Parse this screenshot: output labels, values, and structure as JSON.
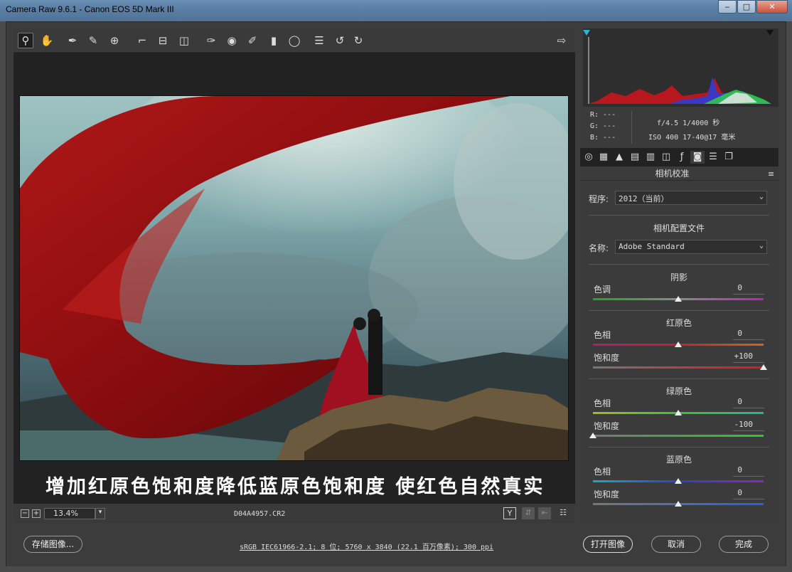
{
  "window": {
    "title": "Camera Raw 9.6.1 -  Canon EOS 5D Mark III"
  },
  "toolbar": {
    "tools": [
      "zoom-icon",
      "hand-icon",
      "white-balance-icon",
      "color-sampler-icon",
      "targeted-adjustment-icon",
      "crop-icon",
      "straighten-icon",
      "transform-icon",
      "spot-removal-icon",
      "red-eye-icon",
      "adjustment-brush-icon",
      "graduated-filter-icon",
      "radial-filter-icon",
      "preferences-icon",
      "rotate-left-icon",
      "rotate-right-icon"
    ],
    "open_in_new": "open-preferences-icon"
  },
  "preview": {
    "caption": "增加红原色饱和度降低蓝原色饱和度  使红色自然真实"
  },
  "status": {
    "zoom_minus": "−",
    "zoom_plus": "+",
    "zoom": "13.4%",
    "filename": "D04A4957.CR2",
    "before_after": "Y"
  },
  "histogram": {
    "rgb": {
      "r": "R:  ---",
      "g": "G:  ---",
      "b": "B:  ---"
    },
    "exif": {
      "aperture_shutter": "f/4.5   1/4000 秒",
      "iso_lens": "ISO 400   17-40@17 毫米"
    }
  },
  "panel": {
    "title": "相机校准",
    "process_label": "程序:",
    "process_value": "2012（当前）",
    "profile_header": "相机配置文件",
    "name_label": "名称:",
    "name_value": "Adobe Standard",
    "shadows": {
      "header": "阴影",
      "tint_label": "色调",
      "tint_value": "0",
      "tint_level": 0
    },
    "red": {
      "header": "红原色",
      "hue_label": "色相",
      "hue_value": "0",
      "sat_label": "饱和度",
      "sat_value": "+100",
      "hue_level": 0,
      "sat_level": 100
    },
    "green": {
      "header": "绿原色",
      "hue_label": "色相",
      "hue_value": "0",
      "sat_label": "饱和度",
      "sat_value": "-100",
      "hue_level": 0,
      "sat_level": -100
    },
    "blue": {
      "header": "蓝原色",
      "hue_label": "色相",
      "hue_value": "0",
      "sat_label": "饱和度",
      "sat_value": "0",
      "hue_level": 0,
      "sat_level": 0
    }
  },
  "bottom": {
    "save": "存储图像...",
    "workflow": "sRGB IEC61966-2.1; 8 位; 5760 x 3840 (22.1 百万像素); 300 ppi",
    "open": "打开图像",
    "cancel": "取消",
    "done": "完成"
  },
  "colors": {
    "accent": "#2bb3d5",
    "background": "#3c3c3c",
    "panel": "#3b3b3b"
  }
}
